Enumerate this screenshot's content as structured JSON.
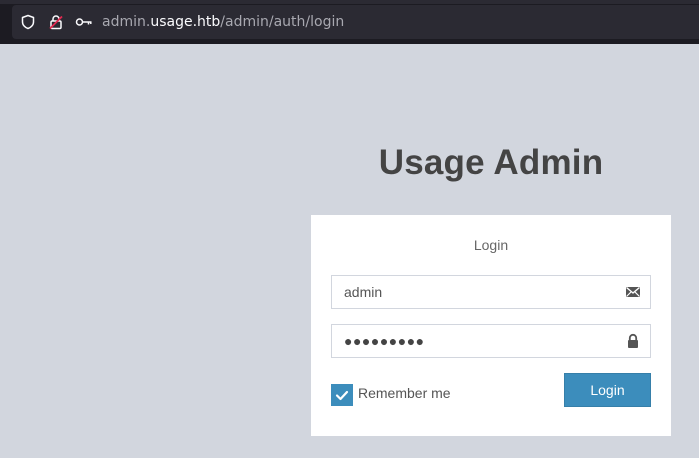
{
  "browser": {
    "url_subdomain": "admin.",
    "url_host": "usage.htb",
    "url_path": "/admin/auth/login",
    "icons": [
      "shield-icon",
      "lock-crossed-icon",
      "key-icon"
    ]
  },
  "page": {
    "brand_title": "Usage Admin",
    "box_message": "Login",
    "username": {
      "value": "admin",
      "icon": "envelope-icon"
    },
    "password": {
      "masked_value": "●●●●●●●●●",
      "icon": "lock-icon"
    },
    "remember": {
      "label": "Remember me",
      "checked": true
    },
    "login_button_label": "Login"
  },
  "colors": {
    "background": "#d2d6de",
    "primary": "#3c8dbc",
    "browser_chrome": "#1c1b22",
    "urlbar": "#2b2a33"
  }
}
